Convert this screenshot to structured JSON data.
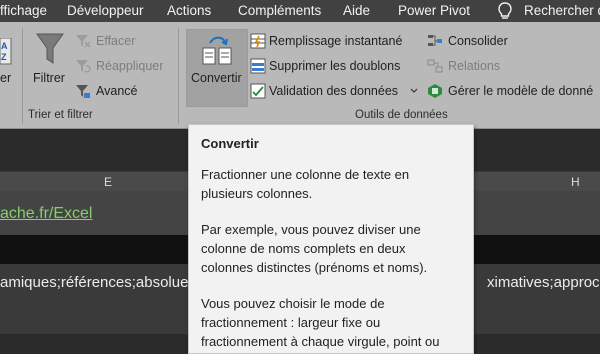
{
  "menu": {
    "tabs": [
      "ffichage",
      "Développeur",
      "Actions",
      "Compléments",
      "Aide",
      "Power Pivot"
    ],
    "search_label": "Rechercher d"
  },
  "ribbon": {
    "trier_filtrer": {
      "sort_label": "er",
      "filter_label": "Filtrer",
      "clear_label": "Effacer",
      "reapply_label": "Réappliquer",
      "advanced_label": "Avancé",
      "group_label": "Trier et filtrer"
    },
    "outils_donnees": {
      "convert_label": "Convertir",
      "flash_fill_label": "Remplissage instantané",
      "remove_duplicates_label": "Supprimer les doublons",
      "data_validation_label": "Validation des données",
      "consolidate_label": "Consolider",
      "relations_label": "Relations",
      "data_model_label": "Gérer le modèle de donné",
      "group_label": "Outils de données"
    }
  },
  "sheet": {
    "col_e": "E",
    "col_h": "H",
    "link_text": "ache.fr/Excel",
    "row_text_left": "amiques;références;absolue",
    "row_text_right": "ximatives;approch"
  },
  "tooltip": {
    "title": "Convertir",
    "p1": "Fractionner une colonne de texte en plusieurs colonnes.",
    "p2": "Par exemple, vous pouvez diviser une colonne de noms complets en deux colonnes distinctes (prénoms et noms).",
    "p3": "Vous pouvez choisir le mode de fractionnement : largeur fixe ou fractionnement à chaque virgule, point ou"
  },
  "colors": {
    "menubar": "#414141",
    "ribbon": "#b9b9b9",
    "link": "#86d06b",
    "tooltip_bg": "#f2f2f2"
  }
}
